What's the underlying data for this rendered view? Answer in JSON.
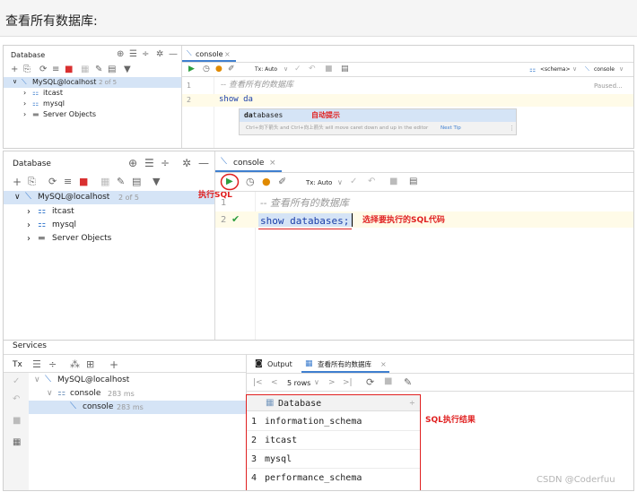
{
  "header": {
    "title": "查看所有数据库:"
  },
  "top": {
    "db_panel": {
      "title": "Database",
      "tree": [
        {
          "label": "MySQL@localhost",
          "badge": "2 of 5"
        },
        {
          "label": "itcast"
        },
        {
          "label": "mysql"
        },
        {
          "label": "Server Objects"
        }
      ]
    },
    "tab": "console",
    "toolbar": {
      "tx": "Tx: Auto",
      "schema": "<schema>",
      "console": "console"
    },
    "status": "Paused...",
    "lines": [
      "1",
      "2"
    ],
    "comment": "-- 查看所有的数据库",
    "code": "show da",
    "completion": {
      "bold": "da",
      "rest": "tabases",
      "hint": "Ctrl+向下箭头 and Ctrl+向上箭头 will move caret down and up in the editor",
      "next_tip": "Next Tip"
    },
    "annotation": "自动提示"
  },
  "bottom": {
    "db_panel": {
      "title": "Database",
      "tree": [
        {
          "label": "MySQL@localhost",
          "badge": "2 of 5"
        },
        {
          "label": "itcast"
        },
        {
          "label": "mysql"
        },
        {
          "label": "Server Objects"
        }
      ]
    },
    "tab": "console",
    "toolbar": {
      "tx": "Tx: Auto"
    },
    "run_annotation": "执行SQL",
    "lines": [
      "1",
      "2"
    ],
    "comment": "-- 查看所有的数据库",
    "code": "show databases;",
    "code_annotation": "选择要执行的SQL代码",
    "services": {
      "title": "Services",
      "tx": "Tx",
      "tree": [
        {
          "label": "MySQL@localhost"
        },
        {
          "label": "console",
          "badge": "283 ms"
        },
        {
          "label": "console",
          "badge": "283 ms"
        }
      ],
      "tabs": [
        "Output",
        "查看所有的数据库"
      ],
      "rows_label": "5 rows",
      "column": "Database",
      "rows": [
        {
          "n": "1",
          "value": "information_schema"
        },
        {
          "n": "2",
          "value": "itcast"
        },
        {
          "n": "3",
          "value": "mysql"
        },
        {
          "n": "4",
          "value": "performance_schema"
        }
      ],
      "result_annotation": "SQL执行结果"
    }
  },
  "watermark": "CSDN @Coderfuu",
  "colors": {
    "accent": "#3f7fcf",
    "annotation": "#e02020",
    "run": "#2e9e3f",
    "stop": "#d93030"
  }
}
